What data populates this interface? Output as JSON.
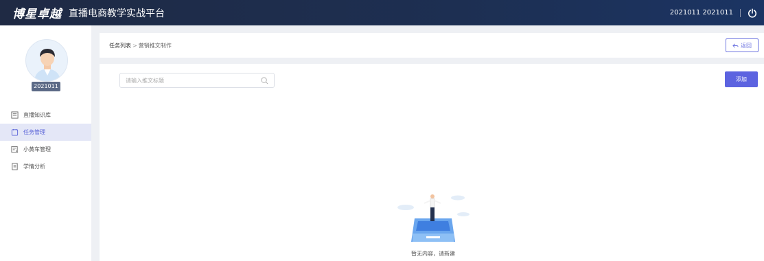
{
  "header": {
    "brand": "博星卓越",
    "title": "直播电商教学实战平台",
    "user": "2021011 2021011"
  },
  "sidebar": {
    "user_id": "2021011",
    "items": [
      {
        "label": "直播知识库",
        "icon": "book-icon"
      },
      {
        "label": "任务管理",
        "icon": "task-icon"
      },
      {
        "label": "小黄车管理",
        "icon": "cart-list-icon"
      },
      {
        "label": "学情分析",
        "icon": "report-icon"
      }
    ],
    "active_index": 1
  },
  "breadcrumb": {
    "parent": "任务列表",
    "separator": ">",
    "current": "营销推文制作",
    "back_label": "返回"
  },
  "main": {
    "search_placeholder": "请输入推文标题",
    "add_label": "添加",
    "empty_text": "暂无内容，请新建"
  },
  "colors": {
    "accent": "#5c63e0",
    "header_bg": "#1f2a44",
    "active_bg": "#e4e7f7"
  }
}
